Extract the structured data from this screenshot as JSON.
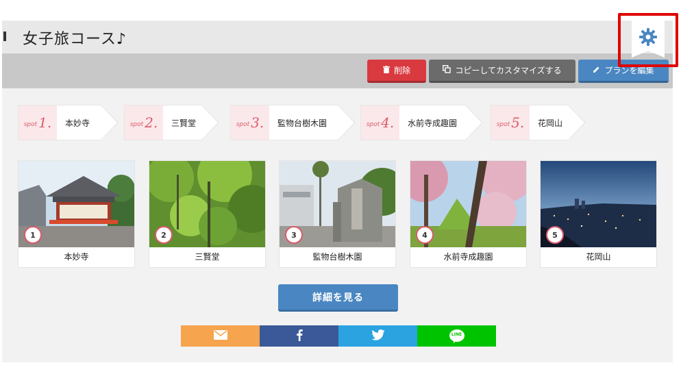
{
  "header": {
    "title": "女子旅コース♪"
  },
  "toolbar": {
    "delete_label": "削除",
    "copy_label": "コピーしてカスタマイズする",
    "edit_label": "プランを編集"
  },
  "spots": [
    {
      "prefix": "spot",
      "number": "1.",
      "name": "本妙寺"
    },
    {
      "prefix": "spot",
      "number": "2.",
      "name": "三賢堂"
    },
    {
      "prefix": "spot",
      "number": "3.",
      "name": "監物台樹木園"
    },
    {
      "prefix": "spot",
      "number": "4.",
      "name": "水前寺成趣園"
    },
    {
      "prefix": "spot",
      "number": "5.",
      "name": "花岡山"
    }
  ],
  "cards": [
    {
      "badge": "1",
      "caption": "本妙寺"
    },
    {
      "badge": "2",
      "caption": "三賢堂"
    },
    {
      "badge": "3",
      "caption": "監物台樹木園"
    },
    {
      "badge": "4",
      "caption": "水前寺成趣園"
    },
    {
      "badge": "5",
      "caption": "花岡山"
    }
  ],
  "details_label": "詳細を見る",
  "share": {
    "line_label": "LINE"
  },
  "icons": {
    "settings": "gear-icon",
    "delete": "trash-icon",
    "copy": "copy-icon",
    "edit": "pencil-icon",
    "mail": "mail-icon",
    "facebook": "facebook-icon",
    "twitter": "twitter-icon",
    "line": "line-icon"
  },
  "colors": {
    "delete": "#d93a40",
    "copy": "#6b6b6b",
    "edit": "#4a87c2",
    "spot_accent": "#d95b6b",
    "mail": "#f6a44d",
    "facebook": "#3b5998",
    "twitter": "#2aa3e0",
    "line": "#00c300",
    "highlight": "#e00000"
  }
}
